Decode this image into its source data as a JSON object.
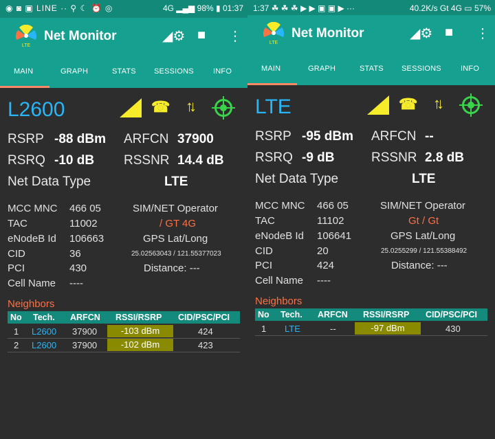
{
  "left": {
    "status": {
      "left_icons": "◉ ◙ ▣ LINE ··  ⚲ ☾ ⏰ ◎",
      "network": "4G",
      "battery": "98%",
      "time": "01:37"
    },
    "app": {
      "title": "Net Monitor",
      "logo_text": "LTE"
    },
    "tabs": [
      "MAIN",
      "GRAPH",
      "STATS",
      "SESSIONS",
      "INFO"
    ],
    "tech": "L2600",
    "metrics": {
      "rsrp_label": "RSRP",
      "rsrp_value": "-88 dBm",
      "rsrq_label": "RSRQ",
      "rsrq_value": "-10 dB",
      "arfcn_label": "ARFCN",
      "arfcn_value": "37900",
      "rssnr_label": "RSSNR",
      "rssnr_value": "14.4 dB",
      "ndt_label": "Net Data Type",
      "ndt_value": "LTE"
    },
    "cell": {
      "mccmnc_label": "MCC MNC",
      "mccmnc_value": "466 05",
      "tac_label": "TAC",
      "tac_value": "11002",
      "enodeb_label": "eNodeB Id",
      "enodeb_value": "106663",
      "cid_label": "CID",
      "cid_value": "36",
      "pci_label": "PCI",
      "pci_value": "430",
      "cellname_label": "Cell Name",
      "cellname_value": "----",
      "operator_label": "SIM/NET Operator",
      "operator_value": "/ GT 4G",
      "gps_label": "GPS Lat/Long",
      "gps_value": "25.02563043 / 121.55377023",
      "distance": "Distance: ---"
    },
    "neighbors": {
      "title": "Neighbors",
      "headers": [
        "No",
        "Tech.",
        "ARFCN",
        "RSSI/RSRP",
        "CID/PSC/PCI"
      ],
      "rows": [
        {
          "no": "1",
          "tech": "L2600",
          "arfcn": "37900",
          "rsrp": "-103 dBm",
          "pci": "424"
        },
        {
          "no": "2",
          "tech": "L2600",
          "arfcn": "37900",
          "rsrp": "-102 dBm",
          "pci": "423"
        }
      ]
    }
  },
  "right": {
    "status": {
      "time": "1:37",
      "left_icons": "☘ ☘ ☘ ▶ ▶ ▣ ▣ ▶ ···",
      "speed": "40.2K/s",
      "carrier": "Gt 4G",
      "battery": "57%"
    },
    "app": {
      "title": "Net Monitor",
      "logo_text": "LTE"
    },
    "tabs": [
      "MAIN",
      "GRAPH",
      "STATS",
      "SESSIONS",
      "INFO"
    ],
    "tech": "LTE",
    "metrics": {
      "rsrp_label": "RSRP",
      "rsrp_value": "-95 dBm",
      "rsrq_label": "RSRQ",
      "rsrq_value": "-9 dB",
      "arfcn_label": "ARFCN",
      "arfcn_value": "--",
      "rssnr_label": "RSSNR",
      "rssnr_value": "2.8 dB",
      "ndt_label": "Net Data Type",
      "ndt_value": "LTE"
    },
    "cell": {
      "mccmnc_label": "MCC MNC",
      "mccmnc_value": "466 05",
      "tac_label": "TAC",
      "tac_value": "11102",
      "enodeb_label": "eNodeB Id",
      "enodeb_value": "106641",
      "cid_label": "CID",
      "cid_value": "20",
      "pci_label": "PCI",
      "pci_value": "424",
      "cellname_label": "Cell Name",
      "cellname_value": "----",
      "operator_label": "SIM/NET Operator",
      "operator_value": "Gt / Gt",
      "gps_label": "GPS Lat/Long",
      "gps_value": "25.0255299 / 121.55388492",
      "distance": "Distance: ---"
    },
    "neighbors": {
      "title": "Neighbors",
      "headers": [
        "No",
        "Tech.",
        "ARFCN",
        "RSSI/RSRP",
        "CID/PSC/PCI"
      ],
      "rows": [
        {
          "no": "1",
          "tech": "LTE",
          "arfcn": "--",
          "rsrp": "-97 dBm",
          "pci": "430"
        }
      ]
    }
  },
  "colors": {
    "appbar": "#16a08f",
    "accent_tab": "#ff8a65",
    "tech_blue": "#29b6f6",
    "signal_yellow": "#f7ec2a",
    "gps_green": "#39d44a",
    "operator_orange": "#ff7043",
    "rsrp_cell": "#8a8a00"
  },
  "icons": [
    "signal-settings-icon",
    "stop-icon",
    "overflow-menu-icon",
    "signal-triangle-icon",
    "phone-icon",
    "up-down-arrows-icon",
    "gps-fix-icon"
  ]
}
